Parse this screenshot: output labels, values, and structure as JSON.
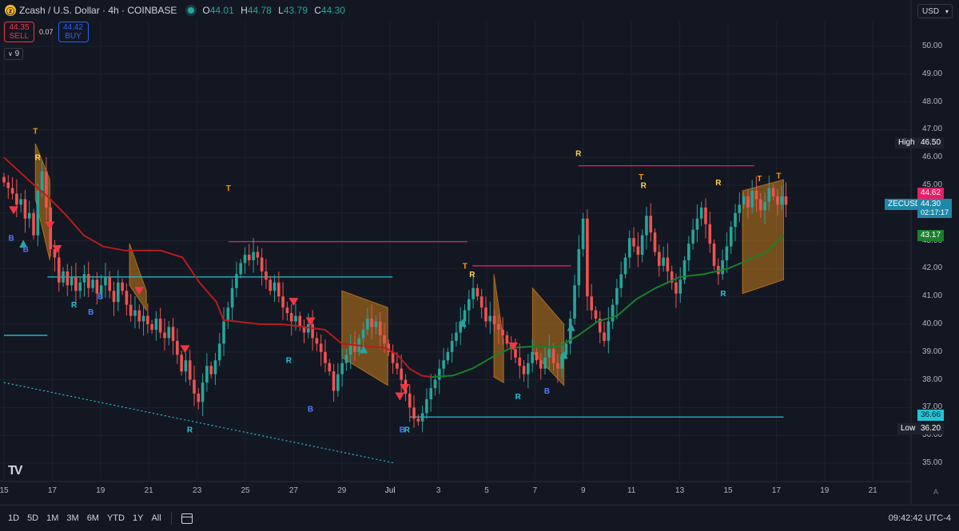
{
  "header": {
    "coin_icon": "zcash-icon",
    "title": "Zcash / U.S. Dollar · 4h · COINBASE",
    "ohlc": [
      {
        "k": "O",
        "v": "44.01"
      },
      {
        "k": "H",
        "v": "44.78"
      },
      {
        "k": "L",
        "v": "43.79"
      },
      {
        "k": "C",
        "v": "44.30"
      }
    ],
    "currency": "USD"
  },
  "trade": {
    "sell_price": "44.35",
    "sell_label": "SELL",
    "spread": "0.07",
    "buy_price": "44.42",
    "buy_label": "BUY"
  },
  "indicators_toggle": "9",
  "price_tags": {
    "high_label": "High",
    "high_value": "46.50",
    "low_label": "Low",
    "low_value": "36.20",
    "red_value": "44.62",
    "symbol": "ZECUSD",
    "last_value": "44.30",
    "countdown": "02:17:17",
    "green_value": "43.17",
    "cyan_value": "36.66"
  },
  "bottom": {
    "ranges": [
      "1D",
      "5D",
      "1M",
      "3M",
      "6M",
      "YTD",
      "1Y",
      "All"
    ],
    "time": "09:42:42 UTC-4"
  },
  "colors": {
    "up": "#26a69a",
    "down": "#ef5350",
    "band": "#c77c1c",
    "cyan": "#22c5d6",
    "magenta": "#e91e63"
  },
  "chart_data": {
    "type": "candlestick",
    "symbol": "ZECUSD",
    "interval": "4h",
    "y_ticks": [
      35.0,
      36.0,
      37.0,
      38.0,
      39.0,
      40.0,
      41.0,
      42.0,
      43.0,
      44.0,
      45.0,
      46.0,
      47.0,
      48.0,
      49.0,
      50.0
    ],
    "ylim": [
      34.6,
      50.8
    ],
    "x_ticks": [
      "15",
      "17",
      "19",
      "21",
      "23",
      "25",
      "27",
      "29",
      "Jul",
      "3",
      "5",
      "7",
      "9",
      "11",
      "13",
      "15",
      "17",
      "19",
      "21"
    ],
    "x_tick_days": [
      15,
      17,
      19,
      21,
      23,
      25,
      27,
      29,
      31,
      33,
      35,
      37,
      39,
      41,
      43,
      45,
      47,
      49,
      51
    ],
    "x_range": [
      15,
      52.5
    ],
    "closes": [
      45.1,
      44.9,
      44.7,
      44.3,
      44.5,
      43.8,
      44.0,
      43.2,
      44.8,
      45.5,
      44.2,
      42.7,
      42.4,
      41.5,
      41.9,
      41.4,
      41.7,
      41.2,
      41.5,
      41.8,
      41.3,
      41.6,
      41.1,
      41.4,
      41.7,
      41.2,
      40.8,
      41.5,
      41.2,
      40.7,
      40.3,
      40.5,
      40.1,
      40.3,
      40.0,
      39.8,
      40.2,
      39.7,
      39.5,
      39.9,
      39.4,
      38.9,
      38.3,
      38.7,
      38.0,
      37.5,
      37.2,
      37.9,
      38.5,
      38.2,
      38.7,
      39.3,
      40.1,
      40.6,
      41.3,
      41.8,
      42.2,
      42.5,
      42.3,
      42.6,
      42.4,
      41.9,
      41.6,
      41.2,
      41.5,
      41.0,
      40.6,
      40.4,
      40.1,
      40.3,
      39.9,
      39.7,
      40.0,
      39.5,
      39.3,
      39.0,
      38.6,
      38.3,
      37.6,
      38.2,
      38.6,
      38.9,
      39.3,
      39.0,
      39.5,
      39.8,
      40.2,
      39.9,
      40.1,
      39.6,
      39.3,
      39.0,
      38.6,
      38.4,
      38.0,
      37.5,
      37.0,
      36.6,
      36.5,
      36.8,
      37.3,
      37.7,
      38.0,
      38.4,
      38.7,
      39.0,
      39.4,
      39.7,
      40.1,
      40.5,
      40.9,
      41.3,
      41.0,
      40.6,
      40.1,
      40.3,
      40.0,
      39.8,
      39.6,
      39.3,
      39.1,
      38.8,
      38.5,
      38.2,
      38.6,
      39.0,
      38.7,
      38.4,
      38.8,
      39.1,
      38.6,
      38.4,
      38.9,
      39.3,
      40.2,
      41.4,
      42.7,
      43.8,
      41.0,
      40.5,
      40.2,
      39.7,
      39.4,
      40.1,
      40.7,
      41.3,
      41.8,
      42.4,
      43.1,
      42.8,
      42.5,
      43.2,
      43.9,
      43.3,
      42.6,
      42.1,
      42.4,
      41.9,
      41.5,
      41.1,
      41.6,
      42.3,
      42.9,
      43.4,
      43.8,
      44.2,
      43.6,
      42.9,
      42.1,
      41.8,
      42.3,
      42.8,
      43.5,
      44.0,
      44.3,
      44.6,
      44.2,
      44.8,
      44.5,
      44.1,
      44.4,
      44.9,
      44.6,
      44.3,
      44.6,
      44.3
    ],
    "series": [
      {
        "name": "",
        "type": "line",
        "color": "#b71c1c",
        "points": [
          [
            15,
            46.0
          ],
          [
            16,
            45.2
          ],
          [
            16.8,
            44.6
          ],
          [
            17.6,
            43.9
          ],
          [
            18.3,
            43.2
          ],
          [
            19.1,
            42.8
          ],
          [
            20.0,
            42.65
          ],
          [
            21.5,
            42.65
          ],
          [
            22.4,
            42.4
          ],
          [
            23.1,
            41.5
          ],
          [
            23.8,
            40.8
          ],
          [
            24.1,
            40.15
          ],
          [
            25.6,
            40.0
          ],
          [
            26.5,
            40.0
          ],
          [
            27.0,
            39.95
          ],
          [
            28.3,
            39.8
          ],
          [
            29.0,
            39.3
          ],
          [
            30.0,
            39.2
          ],
          [
            30.8,
            39.15
          ],
          [
            31.3,
            38.9
          ],
          [
            31.8,
            38.4
          ],
          [
            32.3,
            38.15
          ],
          [
            32.7,
            38.1
          ]
        ]
      },
      {
        "name": "",
        "type": "line",
        "color": "#1b7f2e",
        "points": [
          [
            32.7,
            38.1
          ],
          [
            33.6,
            38.15
          ],
          [
            34.4,
            38.4
          ],
          [
            35.2,
            38.8
          ],
          [
            36.0,
            39.15
          ],
          [
            37.0,
            39.2
          ],
          [
            38.0,
            39.2
          ],
          [
            38.8,
            39.6
          ],
          [
            39.6,
            40.1
          ],
          [
            40.4,
            40.3
          ],
          [
            41.2,
            40.9
          ],
          [
            42.0,
            41.3
          ],
          [
            43.0,
            41.7
          ],
          [
            44.0,
            41.8
          ],
          [
            45.0,
            42.0
          ],
          [
            45.8,
            42.3
          ],
          [
            46.6,
            42.6
          ],
          [
            47.3,
            43.2
          ]
        ]
      }
    ],
    "levels": [
      {
        "color": "#e91e63",
        "value": 42.97,
        "from": 24.3,
        "to": 34.2
      },
      {
        "color": "#e91e63",
        "value": 42.1,
        "from": 34.4,
        "to": 38.5
      },
      {
        "color": "#e91e63",
        "value": 45.7,
        "from": 38.8,
        "to": 46.1
      },
      {
        "color": "#22c5d6",
        "value": 41.7,
        "from": 16.8,
        "to": 31.1
      },
      {
        "color": "#22c5d6",
        "value": 39.6,
        "from": 15,
        "to": 16.8
      },
      {
        "color": "#22c5d6",
        "value": 36.66,
        "from": 31.8,
        "to": 47.3
      }
    ],
    "bands": [
      {
        "color": "#c77c1c",
        "start": [
          16.3,
          46.5,
          44.5
        ],
        "end": [
          16.9,
          45.2,
          42.3
        ]
      },
      {
        "color": "#c77c1c",
        "start": [
          20.2,
          42.9,
          41.4
        ],
        "end": [
          20.9,
          41.2,
          40.5
        ]
      },
      {
        "color": "#c77c1c",
        "start": [
          29.0,
          41.2,
          38.8
        ],
        "end": [
          30.9,
          40.6,
          37.8
        ]
      },
      {
        "color": "#c77c1c",
        "start": [
          35.3,
          41.8,
          38.1
        ],
        "end": [
          35.7,
          39.4,
          37.9
        ]
      },
      {
        "color": "#c77c1c",
        "start": [
          36.9,
          41.3,
          39.0
        ],
        "end": [
          38.2,
          40.0,
          37.8
        ]
      },
      {
        "color": "#c77c1c",
        "start": [
          45.6,
          44.8,
          41.1
        ],
        "end": [
          47.3,
          45.2,
          41.6
        ]
      }
    ],
    "marks": [
      {
        "text": "T",
        "day": 16.3,
        "price": 46.85
      },
      {
        "text": "R",
        "day": 16.4,
        "price": 45.9
      },
      {
        "text": "T",
        "day": 24.3,
        "price": 44.8
      },
      {
        "text": "T",
        "day": 34.1,
        "price": 42.0
      },
      {
        "text": "R",
        "day": 34.4,
        "price": 41.7
      },
      {
        "text": "R",
        "day": 38.8,
        "price": 46.05
      },
      {
        "text": "T",
        "day": 41.4,
        "price": 45.2
      },
      {
        "text": "R",
        "day": 41.5,
        "price": 44.9
      },
      {
        "text": "R",
        "day": 44.6,
        "price": 45.0
      },
      {
        "text": "T",
        "day": 46.3,
        "price": 45.15
      },
      {
        "text": "T",
        "day": 47.1,
        "price": 45.25
      },
      {
        "text": "B",
        "day": 15.3,
        "price": 43.0
      },
      {
        "text": "B",
        "day": 15.9,
        "price": 42.6
      },
      {
        "text": "R",
        "day": 17.9,
        "price": 40.6
      },
      {
        "text": "B",
        "day": 18.6,
        "price": 40.35
      },
      {
        "text": "B",
        "day": 19.0,
        "price": 40.9
      },
      {
        "text": "R",
        "day": 22.7,
        "price": 36.1
      },
      {
        "text": "R",
        "day": 26.8,
        "price": 38.6
      },
      {
        "text": "B",
        "day": 27.7,
        "price": 36.85
      },
      {
        "text": "B",
        "day": 31.5,
        "price": 36.1
      },
      {
        "text": "R",
        "day": 31.7,
        "price": 36.1
      },
      {
        "text": "R",
        "day": 36.3,
        "price": 37.3
      },
      {
        "text": "B",
        "day": 37.5,
        "price": 37.5
      },
      {
        "text": "R",
        "day": 44.8,
        "price": 41.0
      }
    ],
    "signals": [
      {
        "dir": "down",
        "day": 15.4,
        "price": 44.1
      },
      {
        "dir": "up",
        "day": 15.8,
        "price": 42.9
      },
      {
        "dir": "down",
        "day": 16.9,
        "price": 43.55
      },
      {
        "dir": "down",
        "day": 17.2,
        "price": 42.7
      },
      {
        "dir": "down",
        "day": 20.6,
        "price": 41.2
      },
      {
        "dir": "down",
        "day": 22.5,
        "price": 39.1
      },
      {
        "dir": "down",
        "day": 27.0,
        "price": 40.8
      },
      {
        "dir": "down",
        "day": 27.7,
        "price": 40.1
      },
      {
        "dir": "up",
        "day": 29.9,
        "price": 39.1
      },
      {
        "dir": "down",
        "day": 31.4,
        "price": 37.4
      },
      {
        "dir": "down",
        "day": 31.6,
        "price": 37.7
      },
      {
        "dir": "up",
        "day": 34.0,
        "price": 40.05
      },
      {
        "dir": "down",
        "day": 36.1,
        "price": 39.2
      },
      {
        "dir": "up",
        "day": 38.2,
        "price": 38.9
      },
      {
        "dir": "up",
        "day": 38.5,
        "price": 39.9
      }
    ],
    "trendlines": [
      {
        "color": "#22c5d6",
        "from": [
          15,
          37.9
        ],
        "to": [
          31.2,
          35.0
        ]
      }
    ]
  }
}
